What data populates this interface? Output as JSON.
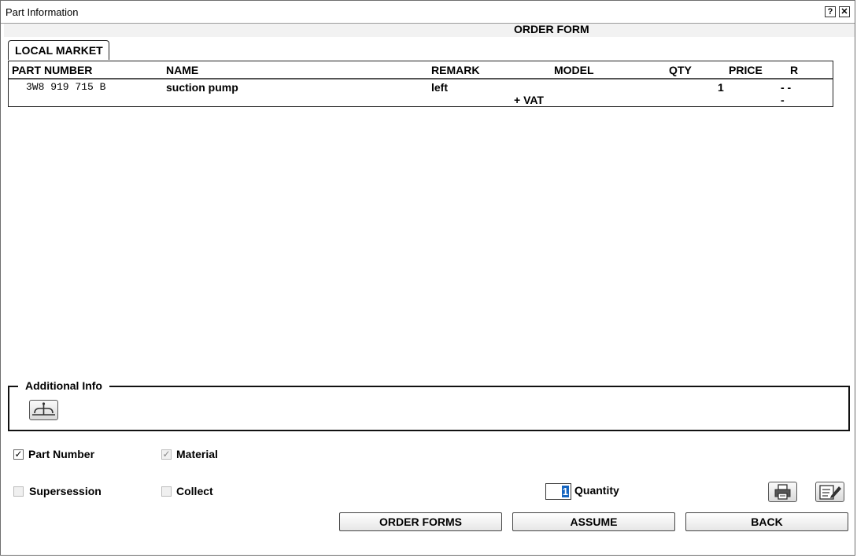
{
  "window": {
    "title": "Part Information",
    "help_label": "?",
    "close_label": "✕"
  },
  "form": {
    "title": "ORDER FORM",
    "tab": "LOCAL MARKET"
  },
  "table": {
    "headers": {
      "part_number": "PART NUMBER",
      "name": "NAME",
      "remark": "REMARK",
      "model": "MODEL",
      "qty": "QTY",
      "price": "PRICE",
      "r": "R"
    },
    "rows": [
      {
        "part_number": "3W8 919 715 B",
        "name": "suction pump",
        "remark": "left",
        "qty": "1",
        "r": "- -",
        "vat_label": "+  VAT",
        "vat_value": "-"
      }
    ]
  },
  "additional_info": {
    "legend": "Additional Info",
    "icon": "scale-icon"
  },
  "options": {
    "part_number": {
      "label": "Part Number",
      "checked": true
    },
    "material": {
      "label": "Material",
      "checked": true
    },
    "supersession": {
      "label": "Supersession",
      "checked": false
    },
    "collect": {
      "label": "Collect",
      "checked": false
    }
  },
  "quantity": {
    "value": "1",
    "label": "Quantity"
  },
  "buttons": {
    "order_forms": "ORDER FORMS",
    "assume": "ASSUME",
    "back": "BACK",
    "print_icon": "printer-icon",
    "edit_icon": "edit-note-icon"
  }
}
